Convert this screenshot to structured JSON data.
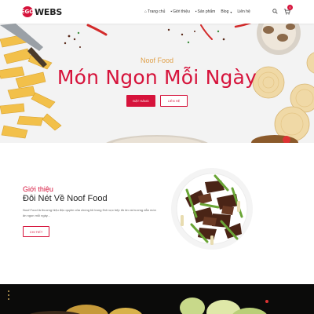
{
  "header": {
    "logo_mark": "EGO",
    "logo_text": "WEBS",
    "nav": [
      {
        "label": "Trang chủ",
        "icon": "home-icon"
      },
      {
        "label": "Giới thiệu",
        "icon": "info-icon"
      },
      {
        "label": "Sản phẩm",
        "icon": "box-icon"
      },
      {
        "label": "Blog",
        "icon": "caret-down-icon"
      },
      {
        "label": "Liên hệ",
        "icon": ""
      }
    ],
    "cart_count": "0"
  },
  "hero": {
    "subtitle": "Noof Food",
    "title": "Món Ngon Mỗi Ngày",
    "order_button": "ĐẶT HÀNG",
    "contact_button": "LIÊN HỆ"
  },
  "about": {
    "subtitle": "Giới thiệu",
    "title": "Đôi Nét Về Noof Food",
    "description": "Noof Food là thương hiệu độc quyền của chúng tôi trong lĩnh vực bếp đồ ăn và hương dẫn món ăn ngon mỗi ngày...",
    "more_button": "CHI TIẾT"
  },
  "colors": {
    "accent": "#d6133b",
    "gold": "#e0a14a"
  }
}
